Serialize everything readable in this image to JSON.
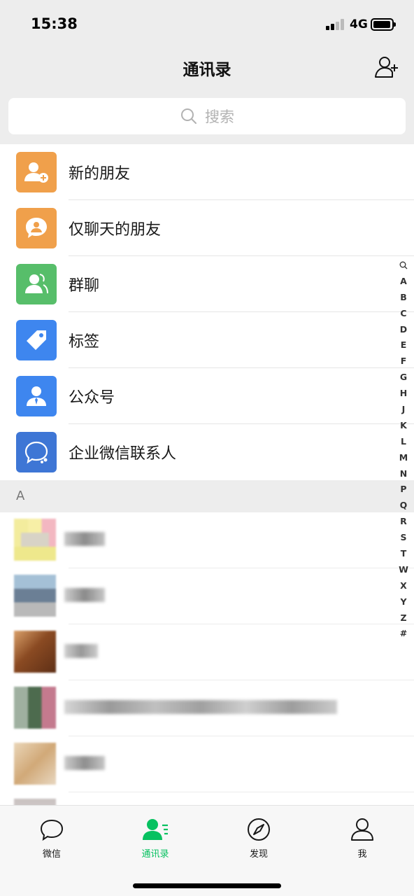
{
  "status_bar": {
    "time": "15:38",
    "network": "4G"
  },
  "nav": {
    "title": "通讯录",
    "add_contact_icon": "add-contact-icon"
  },
  "search": {
    "placeholder": "搜索"
  },
  "features": [
    {
      "label": "新的朋友",
      "icon": "new-friend-icon",
      "color": "#f0a04b"
    },
    {
      "label": "仅聊天的朋友",
      "icon": "chat-only-icon",
      "color": "#f0a04b"
    },
    {
      "label": "群聊",
      "icon": "group-chat-icon",
      "color": "#57be6a"
    },
    {
      "label": "标签",
      "icon": "tag-icon",
      "color": "#3e86ef"
    },
    {
      "label": "公众号",
      "icon": "official-account-icon",
      "color": "#3e86ef"
    },
    {
      "label": "企业微信联系人",
      "icon": "wecom-icon",
      "color": "#3e76d5"
    }
  ],
  "section": {
    "letter": "A"
  },
  "index_letters": [
    "A",
    "B",
    "C",
    "D",
    "E",
    "F",
    "G",
    "H",
    "J",
    "K",
    "L",
    "M",
    "N",
    "P",
    "Q",
    "R",
    "S",
    "T",
    "W",
    "X",
    "Y",
    "Z",
    "#"
  ],
  "tabs": [
    {
      "label": "微信",
      "icon": "chat-bubble-icon",
      "active": false
    },
    {
      "label": "通讯录",
      "icon": "contacts-icon",
      "active": true
    },
    {
      "label": "发现",
      "icon": "compass-icon",
      "active": false
    },
    {
      "label": "我",
      "icon": "profile-icon",
      "active": false
    }
  ],
  "colors": {
    "accent": "#07c160",
    "background": "#ededed"
  }
}
